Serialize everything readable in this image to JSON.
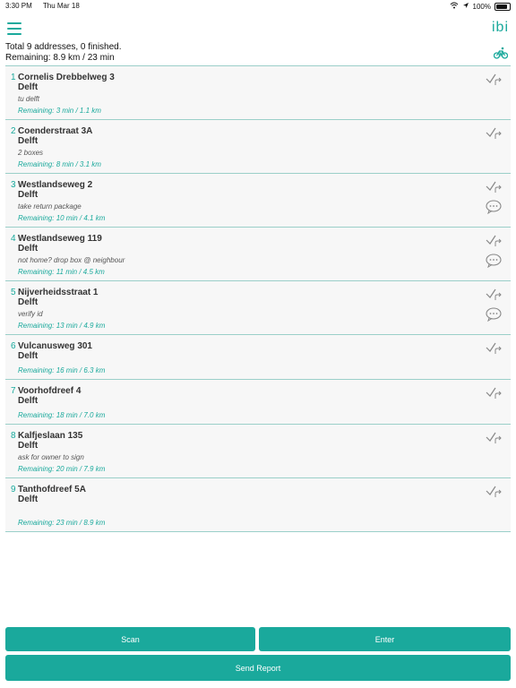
{
  "status": {
    "time": "3:30 PM",
    "date": "Thu Mar 18",
    "battery": "100%"
  },
  "header": {
    "logo": "ibi"
  },
  "summary": {
    "line1": "Total 9 addresses, 0 finished.",
    "line2": "Remaining: 8.9 km / 23 min"
  },
  "stops": [
    {
      "num": "1",
      "street": "Cornelis Drebbelweg 3",
      "city": "Delft",
      "note": "tu delft",
      "remaining": "Remaining: 3 min / 1.1 km",
      "message": false
    },
    {
      "num": "2",
      "street": "Coenderstraat 3A",
      "city": "Delft",
      "note": "2 boxes",
      "remaining": "Remaining: 8 min / 3.1 km",
      "message": false
    },
    {
      "num": "3",
      "street": "Westlandseweg 2",
      "city": "Delft",
      "note": "take return package",
      "remaining": "Remaining: 10 min / 4.1 km",
      "message": true
    },
    {
      "num": "4",
      "street": "Westlandseweg 119",
      "city": "Delft",
      "note": "not home? drop box @ neighbour",
      "remaining": "Remaining: 11 min / 4.5 km",
      "message": true
    },
    {
      "num": "5",
      "street": "Nijverheidsstraat 1",
      "city": "Delft",
      "note": "verify id",
      "remaining": "Remaining: 13 min / 4.9 km",
      "message": true
    },
    {
      "num": "6",
      "street": "Vulcanusweg 301",
      "city": "Delft",
      "note": "",
      "remaining": "Remaining: 16 min / 6.3 km",
      "message": false
    },
    {
      "num": "7",
      "street": "Voorhofdreef 4",
      "city": "Delft",
      "note": "",
      "remaining": "Remaining: 18 min / 7.0 km",
      "message": false
    },
    {
      "num": "8",
      "street": "Kalfjeslaan 135",
      "city": "Delft",
      "note": "ask for owner to sign",
      "remaining": "Remaining: 20 min / 7.9 km",
      "message": false
    },
    {
      "num": "9",
      "street": "Tanthofdreef 5A",
      "city": "Delft",
      "note": "",
      "remaining": "Remaining: 23 min / 8.9 km",
      "message": false
    }
  ],
  "buttons": {
    "scan": "Scan",
    "enter": "Enter",
    "send_report": "Send Report"
  },
  "colors": {
    "accent": "#1aa99c",
    "row_bg": "#f7f7f7",
    "divider": "#9bcfc9"
  }
}
